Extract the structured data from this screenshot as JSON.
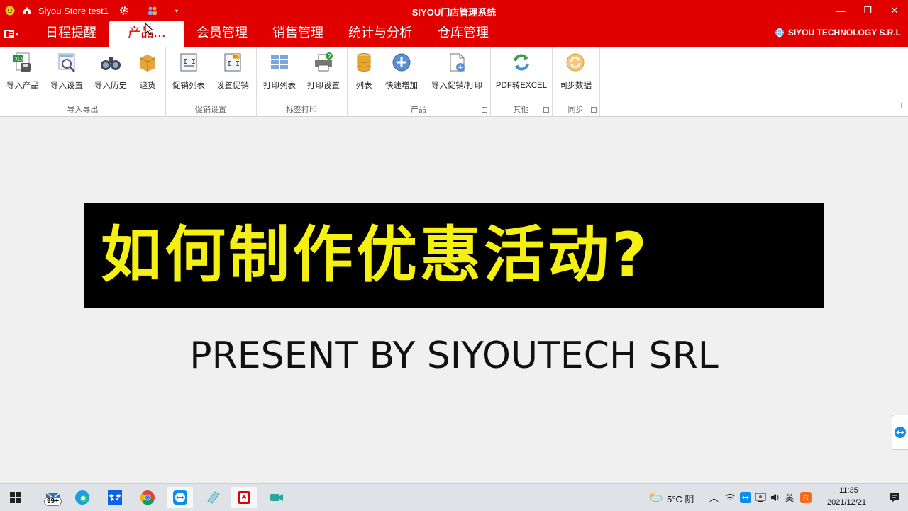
{
  "titlebar": {
    "store_name": "Siyou Store test1",
    "app_title": "SIYOU门店管理系统",
    "minimize": "—",
    "restore": "❐",
    "close": "✕"
  },
  "menubar": {
    "tabs": [
      "日程提醒",
      "产品...",
      "会员管理",
      "销售管理",
      "统计与分析",
      "仓库管理"
    ],
    "brand": "SIYOU TECHNOLOGY S.R.L"
  },
  "ribbon": {
    "groups": [
      {
        "label": "导入导出",
        "buttons": [
          "导入产品",
          "导入设置",
          "导入历史",
          "退货"
        ]
      },
      {
        "label": "促销设置",
        "buttons": [
          "促销列表",
          "设置促销"
        ]
      },
      {
        "label": "标签打印",
        "buttons": [
          "打印列表",
          "打印设置"
        ]
      },
      {
        "label": "产品",
        "buttons": [
          "列表",
          "快速增加",
          "导入促销/打印"
        ]
      },
      {
        "label": "其他",
        "buttons": [
          "PDF转EXCEL"
        ]
      },
      {
        "label": "同步",
        "buttons": [
          "同步数据"
        ]
      }
    ]
  },
  "content": {
    "banner_text": "如何制作优惠活动?",
    "present_text": "PRESENT BY SIYOUTECH SRL"
  },
  "taskbar": {
    "badge": "99+",
    "weather": "5°C 阴",
    "time": "11:35",
    "date": "2021/12/21"
  },
  "colors": {
    "brand_red": "#e00000",
    "banner_yellow": "#f4f012"
  }
}
